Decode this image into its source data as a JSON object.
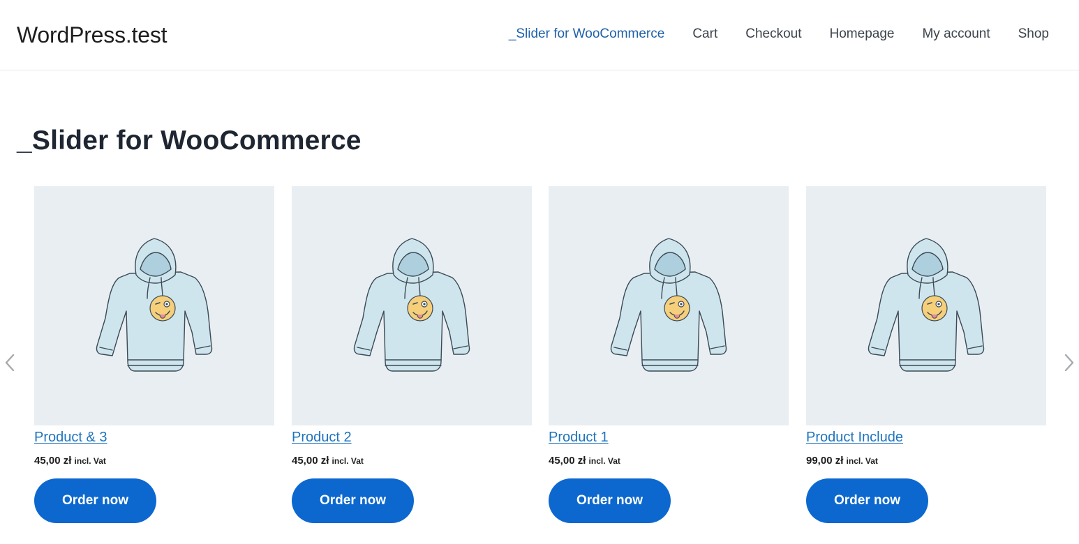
{
  "site": {
    "title": "WordPress.test"
  },
  "nav": {
    "items": [
      {
        "label": "_Slider for WooCommerce",
        "current": true
      },
      {
        "label": "Cart",
        "current": false
      },
      {
        "label": "Checkout",
        "current": false
      },
      {
        "label": "Homepage",
        "current": false
      },
      {
        "label": "My account",
        "current": false
      },
      {
        "label": "Shop",
        "current": false
      }
    ]
  },
  "page": {
    "title": "_Slider for WooCommerce"
  },
  "slider": {
    "prev_icon": "chevron-left-icon",
    "next_icon": "chevron-right-icon",
    "products": [
      {
        "name": "Product & 3",
        "price": "45,00 zł",
        "price_suffix": "incl. Vat",
        "button": "Order now",
        "image_icon": "hoodie-icon"
      },
      {
        "name": "Product 2",
        "price": "45,00 zł",
        "price_suffix": "incl. Vat",
        "button": "Order now",
        "image_icon": "hoodie-icon"
      },
      {
        "name": "Product 1",
        "price": "45,00 zł",
        "price_suffix": "incl. Vat",
        "button": "Order now",
        "image_icon": "hoodie-icon"
      },
      {
        "name": "Product Include",
        "price": "99,00 zł",
        "price_suffix": "incl. Vat",
        "button": "Order now",
        "image_icon": "hoodie-icon"
      }
    ]
  },
  "colors": {
    "accent": "#0c68cf",
    "link": "#1e73be",
    "nav_current": "#1e61aa",
    "image_background": "#e9eef2",
    "hoodie": "#cfe5ee"
  }
}
